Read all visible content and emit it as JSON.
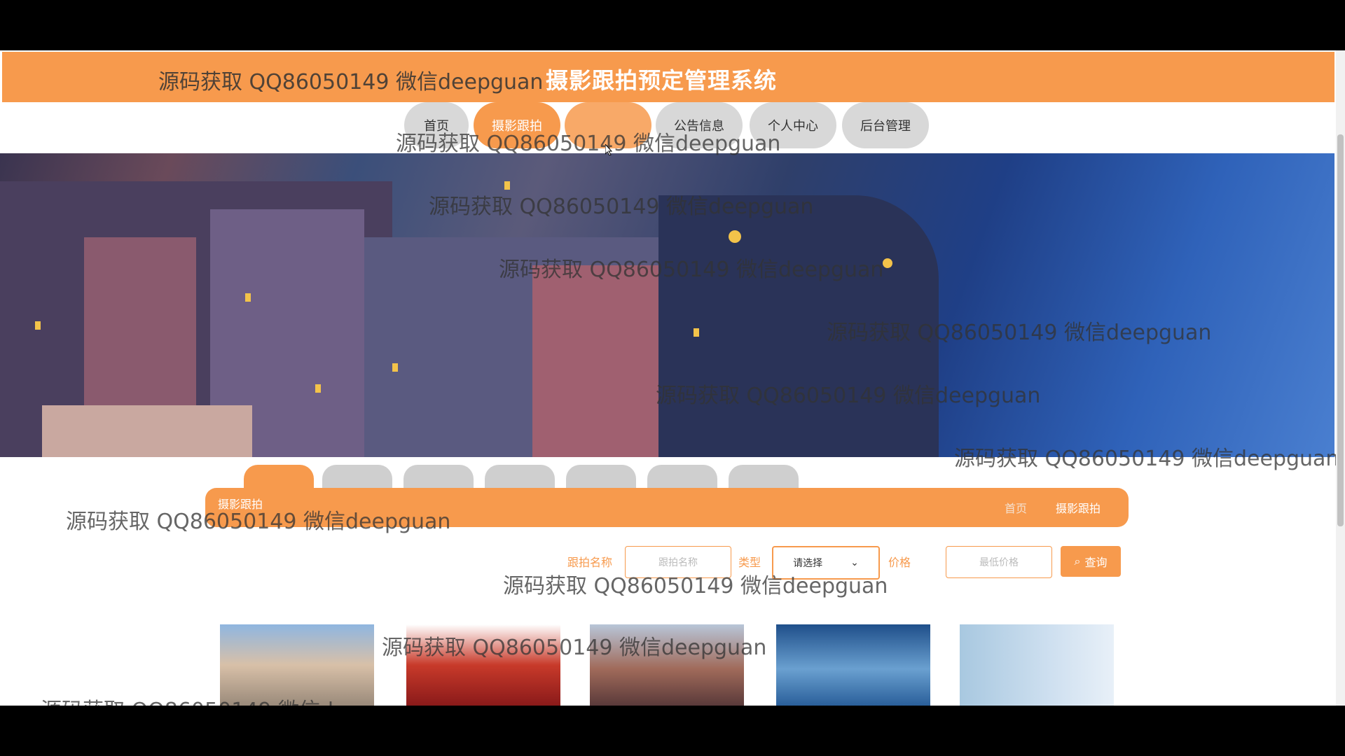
{
  "header": {
    "watermark": "源码获取 QQ86050149 微信deepguan",
    "title": "摄影跟拍预定管理系统"
  },
  "nav": {
    "items": [
      {
        "label": "首页"
      },
      {
        "label": "摄影跟拍"
      },
      {
        "label": ""
      },
      {
        "label": "公告信息"
      },
      {
        "label": "个人中心"
      },
      {
        "label": "后台管理"
      }
    ],
    "active_index": 1
  },
  "carousel": {
    "slide_count": 3
  },
  "tabs": {
    "count": 7,
    "active_index": 0
  },
  "section": {
    "title": "摄影跟拍",
    "more_link": "首页",
    "current": "摄影跟拍"
  },
  "search": {
    "label1": "跟拍名称",
    "input1_placeholder": "跟拍名称",
    "label2": "类型",
    "select_value": "请选择",
    "label3": "价格",
    "input2_placeholder": "最低价格",
    "button_label": "查询"
  },
  "watermarks": [
    "源码获取 QQ86050149 微信deepguan",
    "源码获取 QQ86050149 微信deepguan",
    "源码获取 QQ86050149 微信deepguan",
    "源码获取 QQ86050149 微信deepguan",
    "源码获取 QQ86050149 微信deepguan",
    "源码获取 QQ86050149 微信deepguan",
    "源码获取 QQ86050149 微信deepguan",
    "源码获取 QQ86050149 微信deepguan",
    "源码获取 QQ86050149 微信deepguan",
    "源码获取 QQ86050149 微信deepguan"
  ],
  "colors": {
    "accent": "#f79a4d",
    "inactive": "#d8d8d8"
  }
}
